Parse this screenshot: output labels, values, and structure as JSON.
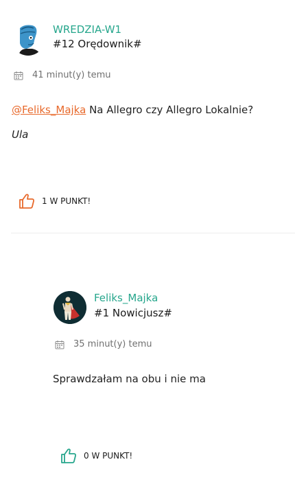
{
  "posts": [
    {
      "author": "WREDZIA-W1",
      "rank": "#12 Orędownik#",
      "time": "41 minut(y) temu",
      "mention": "@Feliks_Majka",
      "text": " Na Allegro czy Allegro Lokalnie?",
      "signature": "Ula",
      "likes": "1 W PUNKT!",
      "author_color": "#26a68c",
      "like_color": "#e8692b"
    },
    {
      "author": "Feliks_Majka",
      "rank": "#1 Nowicjusz#",
      "time": "35 minut(y) temu",
      "text": "Sprawdzałam na obu i nie ma",
      "likes": "0 W PUNKT!",
      "author_color": "#26a68c",
      "like_color": "#26a68c"
    }
  ],
  "icons": {
    "calendar": "calendar-icon",
    "like": "thumbs-up-icon"
  }
}
